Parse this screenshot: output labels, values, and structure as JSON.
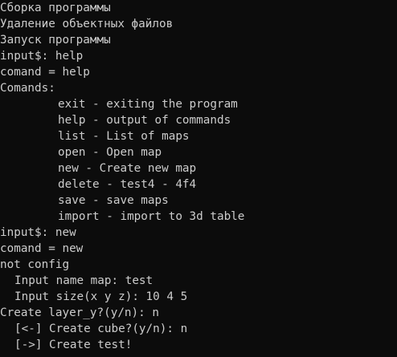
{
  "terminal": {
    "background": "#0c0c0c",
    "foreground": "#cccccc",
    "lines": {
      "l0": "Сборка программы",
      "l1": "Удаление объектных файлов",
      "l2": "Запуск программы",
      "l3": "input$: help",
      "l4": "comand = help",
      "l5": "Comands:",
      "l6": "exit - exiting the program",
      "l7": "help - output of commands",
      "l8": "list - List of maps",
      "l9": "open - Open map",
      "l10": "new - Create new map",
      "l11": "delete - test4 - 4f4",
      "l12": "save - save maps",
      "l13": "import - import to 3d table",
      "l14": "input$: new",
      "l15": "comand = new",
      "l16": "not config",
      "l17": "Input name map: test",
      "l18": "Input size(x y z): 10 4 5",
      "l19": "Create layer_y?(y/n): n",
      "l20": "[<-] Create cube?(y/n): n",
      "l21": "[->] Create test!",
      "l22": ""
    }
  }
}
